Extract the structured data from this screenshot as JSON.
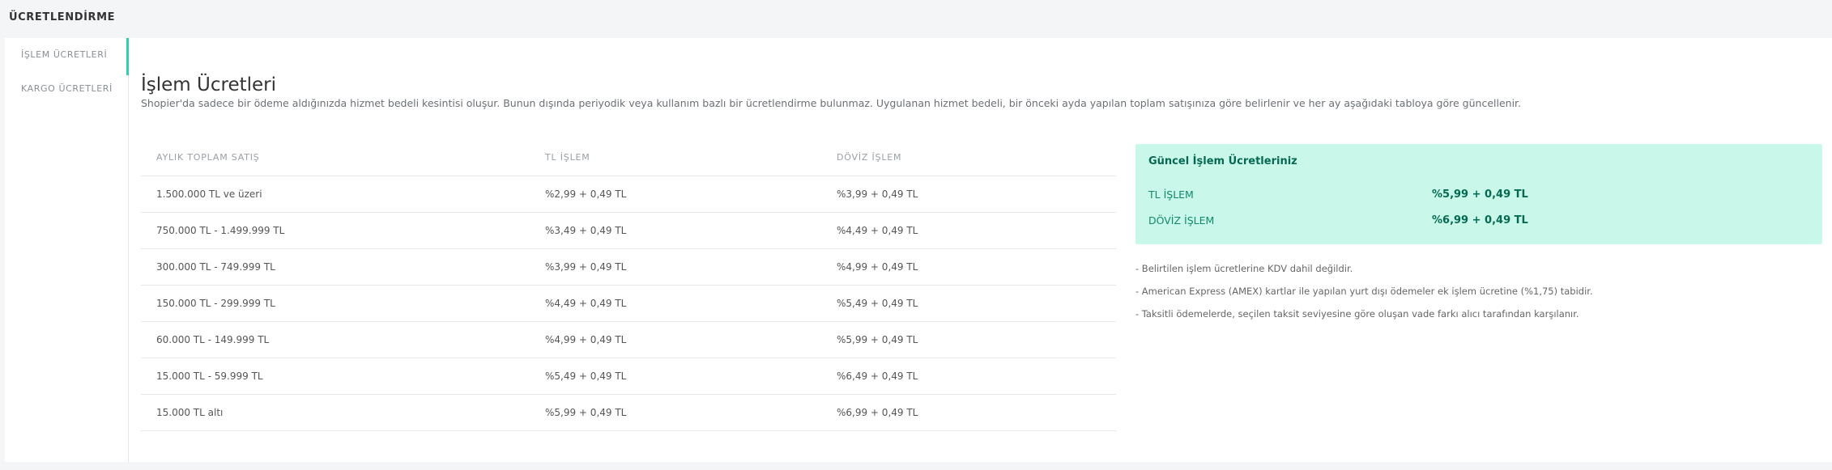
{
  "header": {
    "title": "ÜCRETLENDİRME"
  },
  "sidebar": {
    "items": [
      {
        "label": "İŞLEM ÜCRETLERİ",
        "active": true
      },
      {
        "label": "KARGO ÜCRETLERİ",
        "active": false
      }
    ]
  },
  "main": {
    "title": "İşlem Ücretleri",
    "description": "Shopier'da sadece bir ödeme aldığınızda hizmet bedeli kesintisi oluşur. Bunun dışında periyodik veya kullanım bazlı bir ücretlendirme bulunmaz. Uygulanan hizmet bedeli, bir önceki ayda yapılan toplam satışınıza göre belirlenir ve her ay aşağıdaki tabloya göre güncellenir.",
    "table": {
      "headers": [
        "AYLIK TOPLAM SATIŞ",
        "TL İŞLEM",
        "DÖVİZ İŞLEM"
      ],
      "rows": [
        [
          "1.500.000 TL ve üzeri",
          "%2,99 + 0,49 TL",
          "%3,99 + 0,49 TL"
        ],
        [
          "750.000 TL - 1.499.999 TL",
          "%3,49 + 0,49 TL",
          "%4,49 + 0,49 TL"
        ],
        [
          "300.000 TL - 749.999 TL",
          "%3,99 + 0,49 TL",
          "%4,99 + 0,49 TL"
        ],
        [
          "150.000 TL - 299.999 TL",
          "%4,49 + 0,49 TL",
          "%5,49 + 0,49 TL"
        ],
        [
          "60.000 TL - 149.999 TL",
          "%4,99 + 0,49 TL",
          "%5,99 + 0,49 TL"
        ],
        [
          "15.000 TL - 59.999 TL",
          "%5,49 + 0,49 TL",
          "%6,49 + 0,49 TL"
        ],
        [
          "15.000 TL altı",
          "%5,99 + 0,49 TL",
          "%6,99 + 0,49 TL"
        ]
      ]
    },
    "current": {
      "title": "Güncel İşlem Ücretleriniz",
      "tl_label": "TL İŞLEM",
      "tl_value": "%5,99 + 0,49 TL",
      "fx_label": "DÖVİZ İŞLEM",
      "fx_value": "%6,99 + 0,49 TL"
    },
    "notes": [
      "- Belirtilen işlem ücretlerine KDV dahil değildir.",
      "- American Express (AMEX) kartlar ile yapılan yurt dışı ödemeler ek işlem ücretine (%1,75) tabidir.",
      "- Taksitli ödemelerde, seçilen taksit seviyesine göre oluşan vade farkı alıcı tarafından karşılanır."
    ]
  },
  "colors": {
    "accent": "#2fd0ad",
    "current_box_bg": "#c9f7ea",
    "current_value": "#066a52"
  }
}
